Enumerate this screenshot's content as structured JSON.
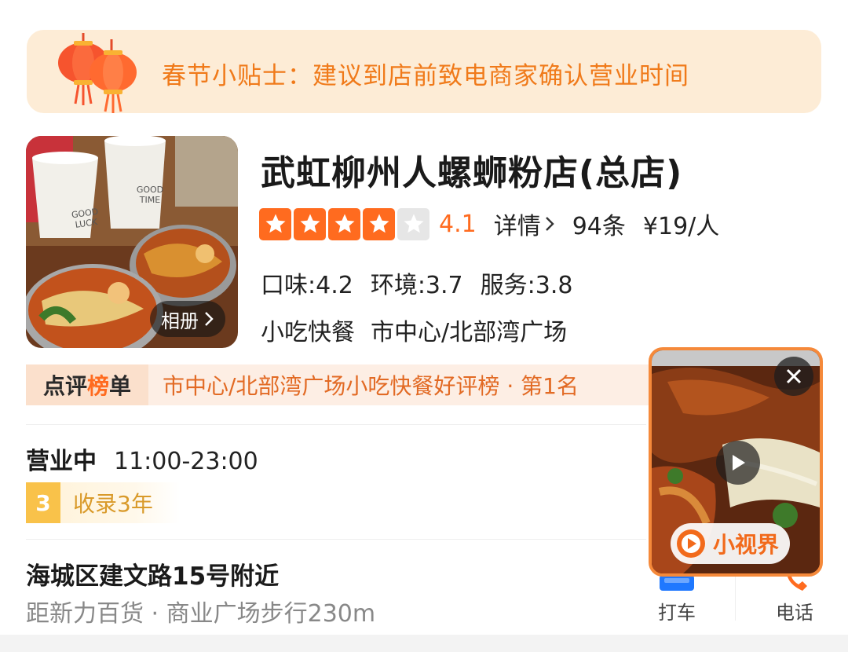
{
  "tip": {
    "text": "春节小贴士：建议到店前致电商家确认营业时间"
  },
  "shop": {
    "name": "武虹柳州人螺蛳粉店(总店)",
    "album_label": "相册",
    "photo_texts": [
      "GOOD LUCK",
      "GOOD TIME"
    ],
    "rating": 4.1,
    "rating_text": "4.1",
    "detail_label": "详情",
    "review_count": "94条",
    "price": "¥19/人",
    "sub_scores": [
      {
        "text": "口味:4.2"
      },
      {
        "text": "环境:3.7"
      },
      {
        "text": "服务:3.8"
      }
    ],
    "category": "小吃快餐",
    "area": "市中心/北部湾广场"
  },
  "ranking": {
    "tag_pre": "点评",
    "tag_arrow": "榜",
    "tag_post": "单",
    "text": "市中心/北部湾广场小吃快餐好评榜 · 第1名"
  },
  "hours": {
    "status": "营业中",
    "time": "11:00-23:00"
  },
  "years": {
    "num": "3",
    "text": "收录3年"
  },
  "address": {
    "main": "海城区建文路15号附近",
    "sub": "距新力百货 · 商业广场步行230m"
  },
  "actions": [
    {
      "label": "打车",
      "icon": "car-icon"
    },
    {
      "label": "电话",
      "icon": "phone-icon"
    }
  ],
  "video": {
    "label": "小视界"
  },
  "colors": {
    "accent": "#ff6b1f",
    "banner_bg": "#fdecd6",
    "banner_text": "#f07a1a",
    "rank_text": "#e26a24",
    "years_badge": "#f9c24a"
  }
}
